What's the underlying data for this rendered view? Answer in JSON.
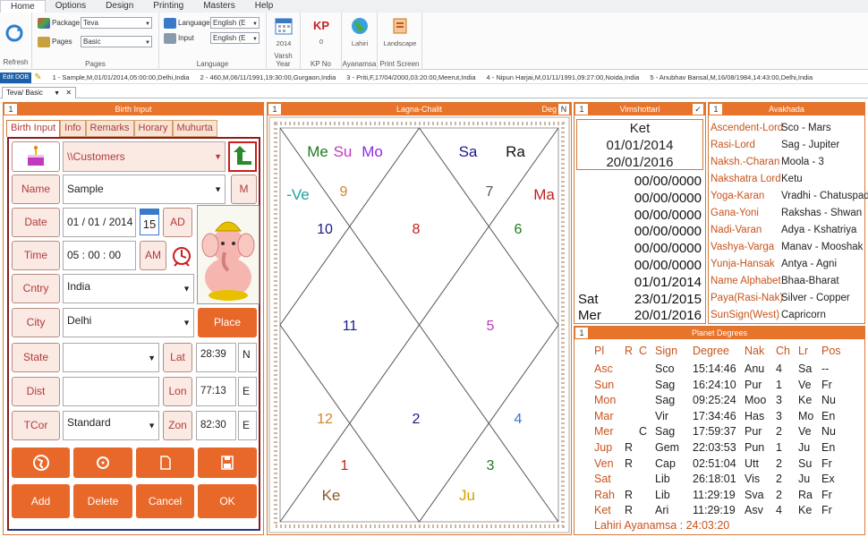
{
  "menu": [
    "Home",
    "Options",
    "Design",
    "Printing",
    "Masters",
    "Help"
  ],
  "ribbon": {
    "refresh": "Refresh",
    "package_label": "Package",
    "package_value": "Teva",
    "pages_label": "Pages",
    "pages_value": "Basic",
    "pages_group": "Pages",
    "language_label": "Language",
    "language_value": "English (E",
    "input_label": "Input",
    "input_value": "English (E",
    "language_group": "Language",
    "year": "2014",
    "year_label": "Varsh Year",
    "kp_value": "0",
    "kp_label": "KP No",
    "ayanamsa_value": "Lahiri",
    "ayanamsa_label": "Ayanamsa",
    "landscape": "Landscape",
    "print_label": "Print Screen"
  },
  "records_bar": {
    "edit_dob": "Edit DOB",
    "records": [
      "1 - Sample,M,01/01/2014,05:00:00,Delhi,India",
      "2 - 460,M,06/11/1991,19:30:00,Gurgaon,India",
      "3 - Priti,F,17/04/2000,03:20:00,Meerut,India",
      "4 - Nipun Harjai,M,01/11/1991,09:27:00,Noida,India",
      "5 - Anubhav Bansal,M,16/08/1984,14:43:00,Delhi,India"
    ]
  },
  "doc_tab": "Teva/ Basic",
  "birth": {
    "title": "Birth Input",
    "num": "1",
    "tabs": [
      "Birth Input",
      "Info",
      "Remarks",
      "Horary",
      "Muhurta"
    ],
    "customers": "\\\\Customers",
    "name_label": "Name",
    "name_value": "Sample",
    "m_label": "M",
    "date_label": "Date",
    "date_value": "01 / 01 / 2014",
    "cal_num": "15",
    "ad": "AD",
    "time_label": "Time",
    "time_value": "05 : 00 : 00",
    "am": "AM",
    "country_label": "Cntry",
    "country_value": "India",
    "city_label": "City",
    "city_value": "Delhi",
    "place_finder": "Place Finder",
    "state_label": "State",
    "lat_label": "Lat",
    "lat_value": "28:39",
    "lat_dir": "N",
    "dist_label": "Dist",
    "lon_label": "Lon",
    "lon_value": "77:13",
    "lon_dir": "E",
    "tcor_label": "TCor",
    "tcor_value": "Standard",
    "zon_label": "Zon",
    "zon_value": "82:30",
    "zon_dir": "E",
    "add": "Add",
    "delete": "Delete",
    "cancel": "Cancel",
    "ok": "OK"
  },
  "lagna": {
    "title": "Lagna-Chalit",
    "num": "1",
    "deg": "Deg",
    "n": "N",
    "houses": [
      "10",
      "8",
      "6",
      "9",
      "7",
      "11",
      "5",
      "12",
      "2",
      "4",
      "1",
      "3"
    ],
    "planets": [
      {
        "t": "Me",
        "c": "#1f7a1f"
      },
      {
        "t": "Su",
        "c": "#c03ac0"
      },
      {
        "t": "Mo",
        "c": "#8a2be2"
      },
      {
        "t": "Sa",
        "c": "#1a1a8a"
      },
      {
        "t": "Ra",
        "c": "#111111"
      },
      {
        "t": "-Ve",
        "c": "#1aa0a0"
      },
      {
        "t": "Ma",
        "c": "#c02020"
      },
      {
        "t": "Ke",
        "c": "#8a5a2a"
      },
      {
        "t": "Ju",
        "c": "#d4a000"
      }
    ]
  },
  "vimshottari": {
    "title": "Vimshottari",
    "num": "1",
    "planet": "Ket",
    "start": "01/01/2014",
    "end": "20/01/2016",
    "rows": [
      {
        "d": "",
        "v": "00/00/0000"
      },
      {
        "d": "",
        "v": "00/00/0000"
      },
      {
        "d": "",
        "v": "00/00/0000"
      },
      {
        "d": "",
        "v": "00/00/0000"
      },
      {
        "d": "",
        "v": "00/00/0000"
      },
      {
        "d": "",
        "v": "00/00/0000"
      },
      {
        "d": "",
        "v": "01/01/2014"
      },
      {
        "d": "Sat",
        "v": "23/01/2015"
      },
      {
        "d": "Mer",
        "v": "20/01/2016"
      }
    ]
  },
  "avakhada": {
    "title": "Avakhada",
    "num": "1",
    "rows": [
      {
        "k": "Ascendent-Lord",
        "v": "Sco - Mars"
      },
      {
        "k": "Rasi-Lord",
        "v": "Sag - Jupiter"
      },
      {
        "k": "Naksh.-Charan",
        "v": "Moola - 3"
      },
      {
        "k": "Nakshatra Lord",
        "v": "Ketu"
      },
      {
        "k": "Yoga-Karan",
        "v": "Vradhi - Chatuspada"
      },
      {
        "k": "Gana-Yoni",
        "v": "Rakshas - Shwan"
      },
      {
        "k": "Nadi-Varan",
        "v": "Adya - Kshatriya"
      },
      {
        "k": "Vashya-Varga",
        "v": "Manav - Mooshak"
      },
      {
        "k": "Yunja-Hansak",
        "v": "Antya - Agni"
      },
      {
        "k": "Name Alphabet",
        "v": "Bhaa-Bharat"
      },
      {
        "k": "Paya(Rasi-Nak)",
        "v": "Silver - Copper"
      },
      {
        "k": "SunSign(West)",
        "v": "Capricorn"
      }
    ]
  },
  "planet_degrees": {
    "title": "Planet Degrees",
    "num": "1",
    "headers": [
      "Pl",
      "R",
      "C",
      "Sign",
      "Degree",
      "Nak",
      "Ch",
      "Lr",
      "Pos"
    ],
    "rows": [
      [
        "Asc",
        "",
        "",
        "Sco",
        "15:14:46",
        "Anu",
        "4",
        "Sa",
        "--"
      ],
      [
        "Sun",
        "",
        "",
        "Sag",
        "16:24:10",
        "Pur",
        "1",
        "Ve",
        "Fr"
      ],
      [
        "Mon",
        "",
        "",
        "Sag",
        "09:25:24",
        "Moo",
        "3",
        "Ke",
        "Nu"
      ],
      [
        "Mar",
        "",
        "",
        "Vir",
        "17:34:46",
        "Has",
        "3",
        "Mo",
        "En"
      ],
      [
        "Mer",
        "",
        "C",
        "Sag",
        "17:59:37",
        "Pur",
        "2",
        "Ve",
        "Nu"
      ],
      [
        "Jup",
        "R",
        "",
        "Gem",
        "22:03:53",
        "Pun",
        "1",
        "Ju",
        "En"
      ],
      [
        "Ven",
        "R",
        "",
        "Cap",
        "02:51:04",
        "Utt",
        "2",
        "Su",
        "Fr"
      ],
      [
        "Sat",
        "",
        "",
        "Lib",
        "26:18:01",
        "Vis",
        "2",
        "Ju",
        "Ex"
      ],
      [
        "Rah",
        "R",
        "",
        "Lib",
        "11:29:19",
        "Sva",
        "2",
        "Ra",
        "Fr"
      ],
      [
        "Ket",
        "R",
        "",
        "Ari",
        "11:29:19",
        "Asv",
        "4",
        "Ke",
        "Fr"
      ]
    ],
    "footer": "Lahiri Ayanamsa : 24:03:20"
  }
}
